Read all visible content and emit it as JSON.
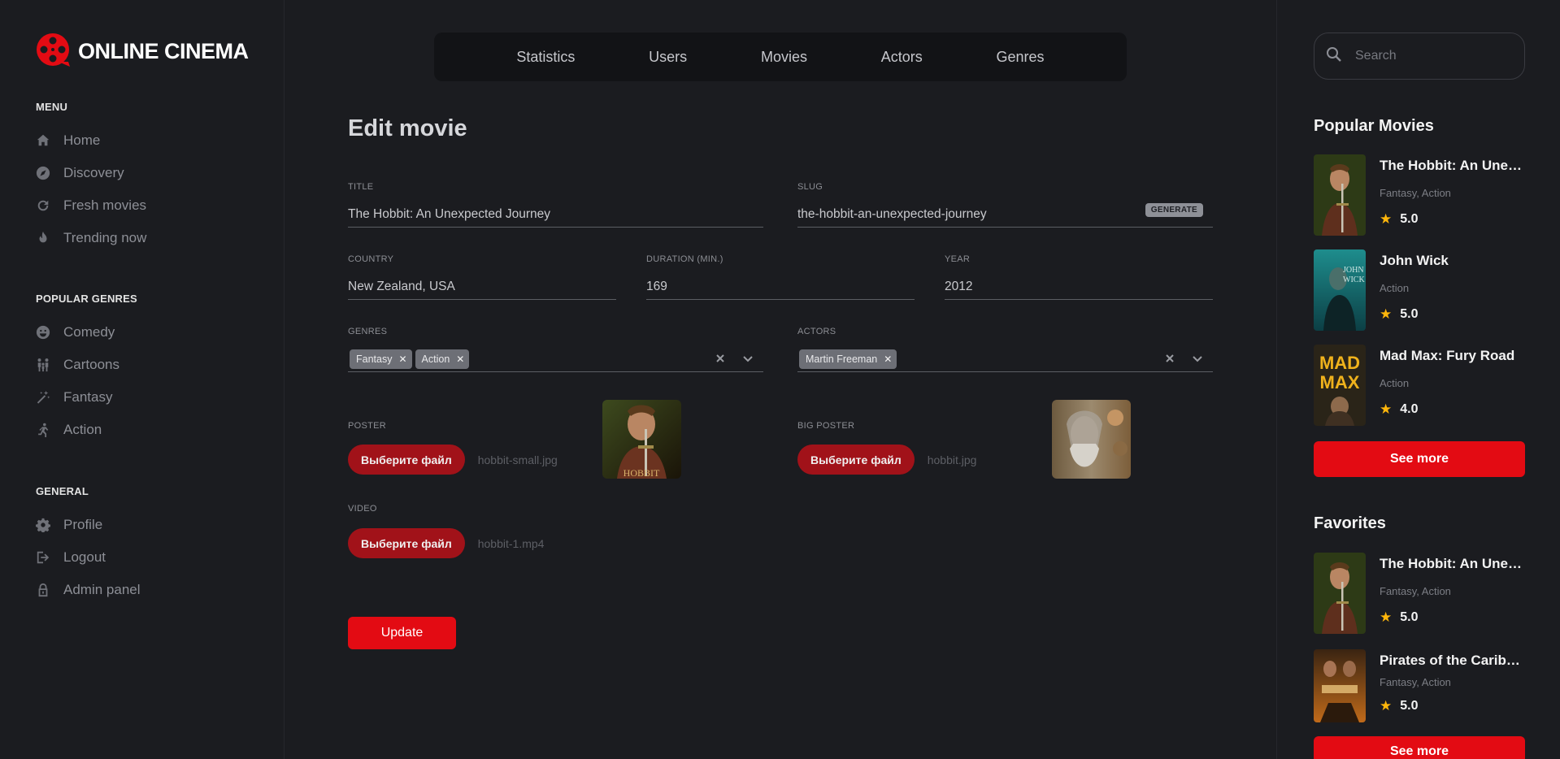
{
  "app": {
    "logo_text": "ONLINE CINEMA"
  },
  "sidebar": {
    "menu": {
      "heading": "Menu",
      "items": [
        {
          "label": "Home",
          "icon": "home-icon"
        },
        {
          "label": "Discovery",
          "icon": "compass-icon"
        },
        {
          "label": "Fresh movies",
          "icon": "refresh-icon"
        },
        {
          "label": "Trending now",
          "icon": "fire-icon"
        }
      ]
    },
    "genres": {
      "heading": "Popular genres",
      "items": [
        {
          "label": "Comedy",
          "icon": "smile-icon"
        },
        {
          "label": "Cartoons",
          "icon": "family-icon"
        },
        {
          "label": "Fantasy",
          "icon": "magic-wand-icon"
        },
        {
          "label": "Action",
          "icon": "running-icon"
        }
      ]
    },
    "general": {
      "heading": "General",
      "items": [
        {
          "label": "Profile",
          "icon": "gear-icon"
        },
        {
          "label": "Logout",
          "icon": "logout-icon"
        },
        {
          "label": "Admin panel",
          "icon": "lock-icon"
        }
      ]
    }
  },
  "topnav": [
    "Statistics",
    "Users",
    "Movies",
    "Actors",
    "Genres"
  ],
  "form": {
    "title": "Edit movie",
    "fields": {
      "title": {
        "label": "Title",
        "value": "The Hobbit: An Unexpected Journey"
      },
      "slug": {
        "label": "Slug",
        "value": "the-hobbit-an-unexpected-journey",
        "generate": "GENERATE"
      },
      "country": {
        "label": "Country",
        "value": "New Zealand, USA"
      },
      "duration": {
        "label": "Duration (min.)",
        "value": "169"
      },
      "year": {
        "label": "Year",
        "value": "2012"
      },
      "genres": {
        "label": "Genres",
        "chips": [
          "Fantasy",
          "Action"
        ]
      },
      "actors": {
        "label": "Actors",
        "chips": [
          "Martin Freeman"
        ]
      },
      "poster": {
        "label": "Poster",
        "button": "Выберите файл",
        "file": "hobbit-small.jpg"
      },
      "big_poster": {
        "label": "Big poster",
        "button": "Выберите файл",
        "file": "hobbit.jpg"
      },
      "video": {
        "label": "Video",
        "button": "Выберите файл",
        "file": "hobbit-1.mp4"
      }
    },
    "submit": "Update"
  },
  "right": {
    "search_placeholder": "Search",
    "popular": {
      "heading": "Popular Movies",
      "movies": [
        {
          "title": "The Hobbit: An Unexpected Journey",
          "genres": "Fantasy, Action",
          "rating": "5.0"
        },
        {
          "title": "John Wick",
          "genres": "Action",
          "rating": "5.0"
        },
        {
          "title": "Mad Max: Fury Road",
          "genres": "Action",
          "rating": "4.0"
        }
      ],
      "see_more": "See more"
    },
    "favorites": {
      "heading": "Favorites",
      "movies": [
        {
          "title": "The Hobbit: An Unexpected Journey",
          "genres": "Fantasy, Action",
          "rating": "5.0"
        },
        {
          "title": "Pirates of the Caribbean",
          "genres": "Fantasy, Action",
          "rating": "5.0"
        }
      ],
      "see_more": "See more"
    }
  },
  "colors": {
    "accent": "#e30b13",
    "file_button": "#a11219",
    "background": "#1b1c20",
    "star": "#ffb60b"
  }
}
